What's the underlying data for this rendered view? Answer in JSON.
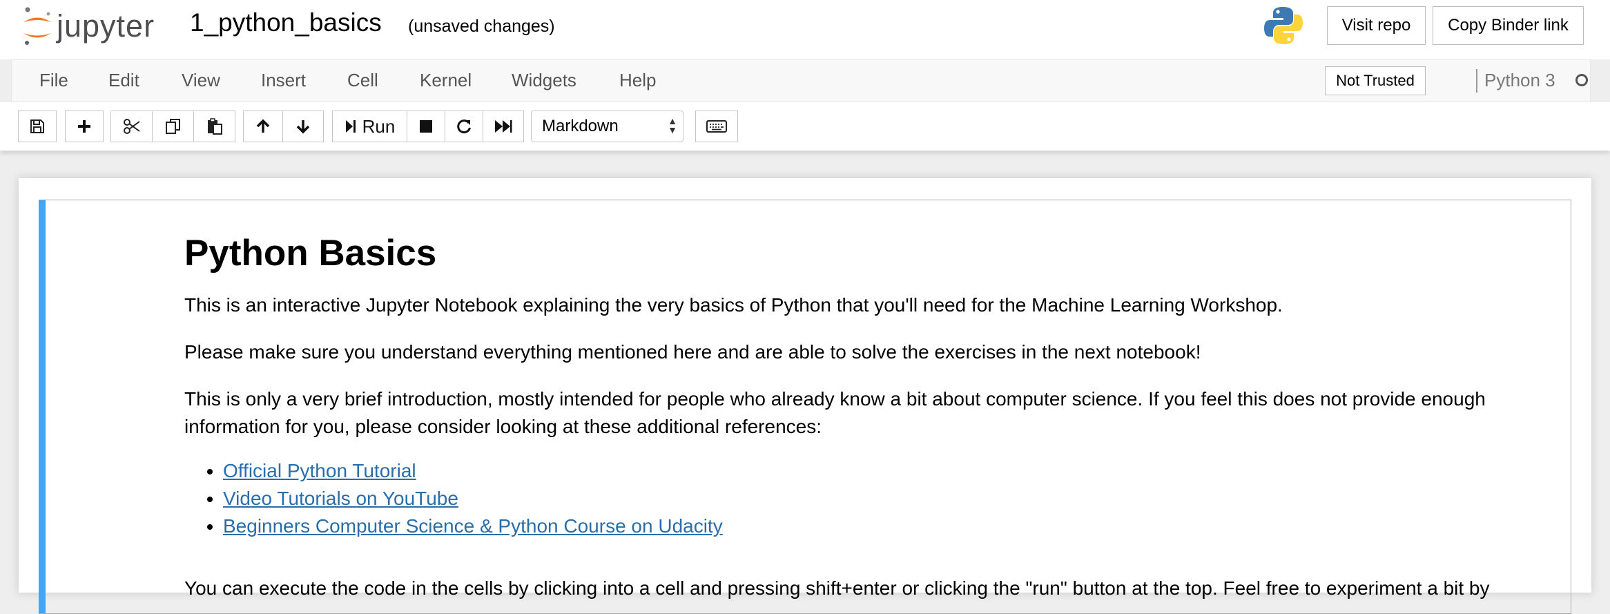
{
  "header": {
    "logo_text": "jupyter",
    "notebook_title": "1_python_basics",
    "save_status": "(unsaved changes)",
    "visit_repo_label": "Visit repo",
    "copy_binder_label": "Copy Binder link"
  },
  "menubar": {
    "items": [
      "File",
      "Edit",
      "View",
      "Insert",
      "Cell",
      "Kernel",
      "Widgets",
      "Help"
    ],
    "trust_label": "Not Trusted",
    "kernel_name": "Python 3"
  },
  "toolbar": {
    "buttons": [
      "save-icon",
      "plus-icon",
      "cut-icon",
      "copy-icon",
      "paste-icon",
      "arrow-up-icon",
      "arrow-down-icon",
      "run-icon",
      "stop-icon",
      "restart-icon",
      "fast-forward-icon",
      "keyboard-icon"
    ],
    "run_label": "Run",
    "cell_type": "Markdown"
  },
  "cell": {
    "heading": "Python Basics",
    "paragraphs": [
      "This is an interactive Jupyter Notebook explaining the very basics of Python that you'll need for the Machine Learning Workshop.",
      "Please make sure you understand everything mentioned here and are able to solve the exercises in the next notebook!",
      "This is only a very brief introduction, mostly intended for people who already know a bit about computer science. If you feel this does not provide enough information for you, please consider looking at these additional references:",
      "You can execute the code in the cells by clicking into a cell and pressing shift+enter or clicking the \"run\" button at the top. Feel free to experiment a bit by"
    ],
    "links": [
      "Official Python Tutorial",
      "Video Tutorials on YouTube",
      "Beginners Computer Science & Python Course on Udacity"
    ]
  },
  "colors": {
    "jupyter_orange": "#f37726",
    "cell_selected_marker": "#42a5f5",
    "link": "#296eaa"
  }
}
